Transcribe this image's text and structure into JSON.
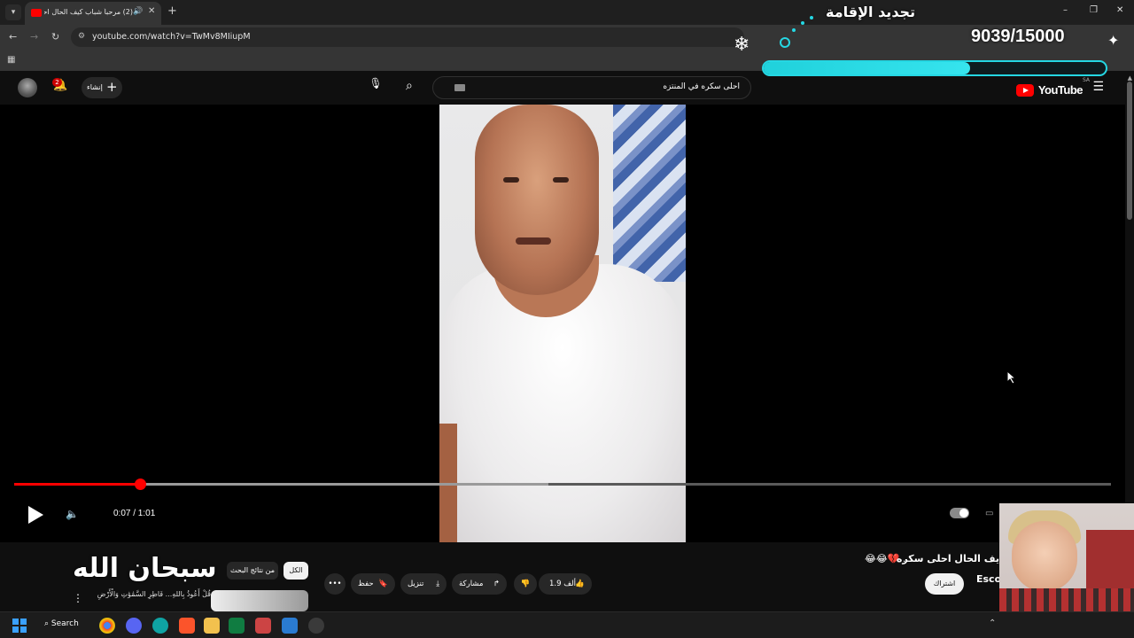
{
  "browser": {
    "tab_title": "(2) مرحباً شباب كيف الحال احلى",
    "url": "youtube.com/watch?v=TwMv8MIiupM"
  },
  "overlay": {
    "title": "تجديد الإقامة",
    "counter": "9039/15000",
    "progress": 0.6026
  },
  "youtube": {
    "logo": "YouTube",
    "country": "SA",
    "search_query": "احلى سكره في المنتزه",
    "create_label": "إنشاء",
    "notification_count": "2"
  },
  "player": {
    "time": "0:07 / 1:01",
    "played_fraction": 0.115,
    "buffered_fraction": 0.487
  },
  "video": {
    "title": "يف الحال احلى سكره",
    "title_emoji": "😂😂💔 .",
    "channel": "Esco",
    "subscribe_label": "اشتراك",
    "like_count": "1.9 ألف",
    "share_label": "مشاركة",
    "download_label": "تنزيل",
    "save_label": "حفظ"
  },
  "related": {
    "chip_all": "الكل",
    "chip_search": "من نتائج البحث",
    "overlay_text": "سبحان الله",
    "verse": "قُلْ أَعُوذُ بِاللهِ... فَاطِرِ السَّمَٰوَٰتِ وَالْأَرْضِ"
  },
  "taskbar": {
    "search_label": "Search"
  },
  "colors": {
    "yt_red": "#ff0000",
    "overlay_accent": "#25d7e3"
  }
}
